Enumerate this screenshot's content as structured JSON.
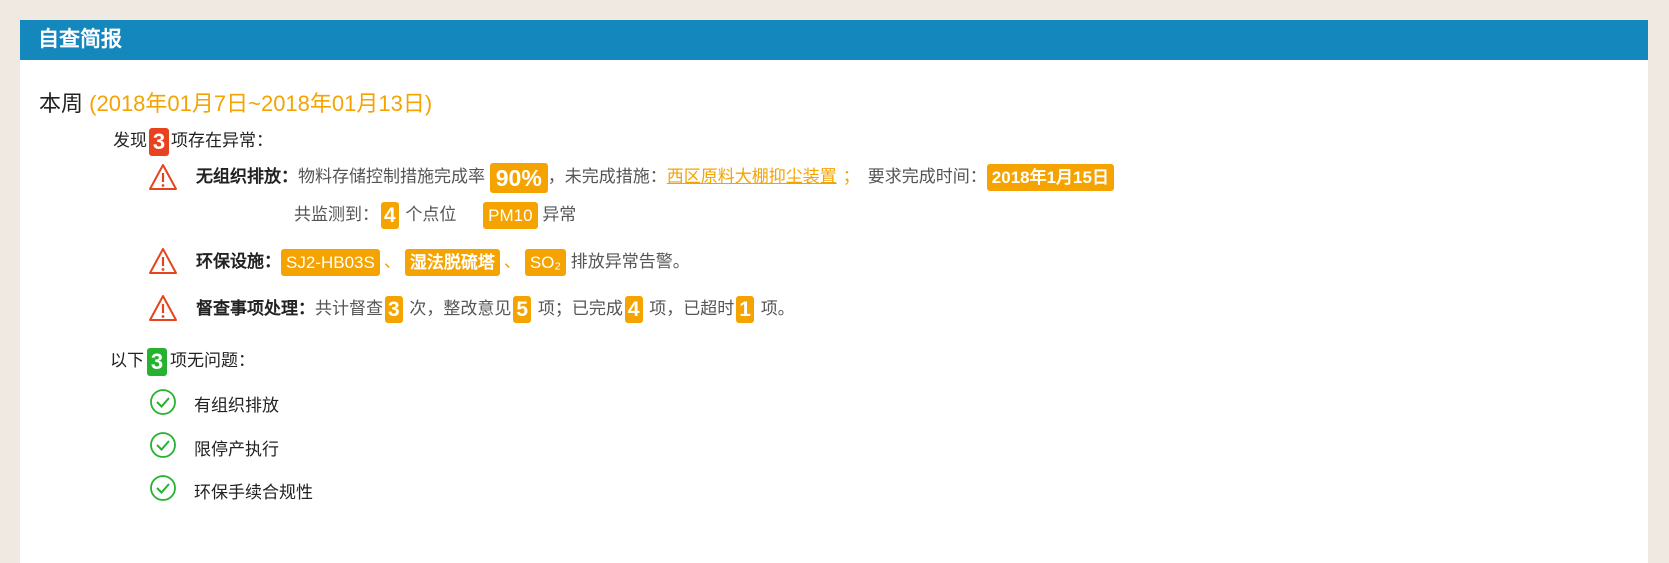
{
  "header": {
    "title": "自查简报"
  },
  "week": {
    "label": "本周",
    "range": "(2018年01月7日~2018年01月13日)"
  },
  "abnormal": {
    "prefix": "发现",
    "count": "3",
    "suffix": "项存在异常：",
    "items": {
      "fugitive": {
        "label": "无组织排放：",
        "text1": "物料存储控制措施完成率",
        "rate": "90%",
        "text2": "，未完成措施：",
        "measure": "西区原料大棚抑尘装置",
        "semi": "；",
        "text3": "要求完成时间：",
        "deadline": "2018年1月15日",
        "line2_prefix": "共监测到：",
        "points": "4",
        "line2_mid": "个点位",
        "pollutant": "PM10",
        "line2_suffix": "异常"
      },
      "facilities": {
        "label": "环保设施：",
        "tags": [
          "SJ2-HB03S",
          "湿法脱硫塔",
          "SO₂"
        ],
        "sep": "、",
        "suffix": "排放异常告警。"
      },
      "supervision": {
        "label": "督查事项处理：",
        "t1": "共计督查",
        "n1": "3",
        "t2": "次，整改意见",
        "n2": "5",
        "t3": "项；已完成",
        "n3": "4",
        "t4": "项，已超时",
        "n4": "1",
        "t5": "项。"
      }
    }
  },
  "normal": {
    "prefix": "以下",
    "count": "3",
    "suffix": "项无问题：",
    "items": [
      "有组织排放",
      "限停产执行",
      "环保手续合规性"
    ]
  },
  "colors": {
    "header": "#1487bd",
    "accent": "#f5a300",
    "danger": "#e8431f",
    "ok": "#25b22f"
  },
  "icons": {
    "warning": "warning-triangle-icon",
    "ok": "check-circle-icon"
  }
}
